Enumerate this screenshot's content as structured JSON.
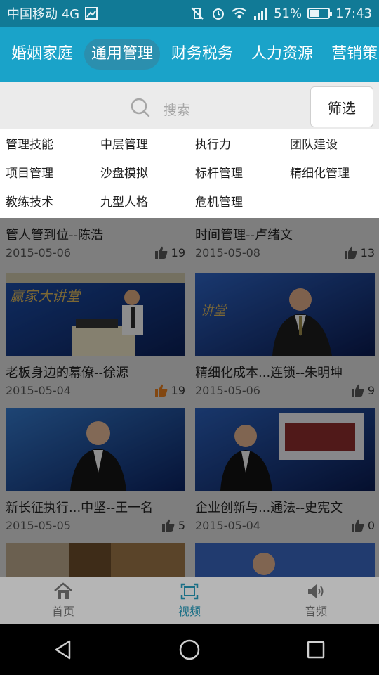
{
  "status": {
    "carrier": "中国移动 4G",
    "battery": "51%",
    "battery_level": 0.51,
    "time": "17:43"
  },
  "categories": [
    {
      "label": "婚姻家庭",
      "active": false
    },
    {
      "label": "通用管理",
      "active": true
    },
    {
      "label": "财务税务",
      "active": false
    },
    {
      "label": "人力资源",
      "active": false
    },
    {
      "label": "营销策",
      "active": false
    }
  ],
  "search": {
    "placeholder": "搜索",
    "filter_label": "筛选"
  },
  "filters": [
    "管理技能",
    "中层管理",
    "执行力",
    "团队建设",
    "项目管理",
    "沙盘模拟",
    "标杆管理",
    "精细化管理",
    "教练技术",
    "九型人格",
    "危机管理"
  ],
  "videos": [
    {
      "title": "管人管到位--陈浩",
      "date": "2015-05-06",
      "likes": "19",
      "liked": false
    },
    {
      "title": "时间管理--卢绪文",
      "date": "2015-05-08",
      "likes": "13",
      "liked": false
    },
    {
      "title": "老板身边的幕僚--徐源",
      "date": "2015-05-04",
      "likes": "19",
      "liked": true
    },
    {
      "title": "精细化成本...连锁--朱明坤",
      "date": "2015-05-06",
      "likes": "9",
      "liked": false
    },
    {
      "title": "新长征执行...中坚--王一名",
      "date": "2015-05-05",
      "likes": "5",
      "liked": false
    },
    {
      "title": "企业创新与...通法--史宪文",
      "date": "2015-05-04",
      "likes": "0",
      "liked": false
    }
  ],
  "nav": [
    {
      "label": "首页",
      "icon": "home-icon",
      "active": false
    },
    {
      "label": "视频",
      "icon": "video-icon",
      "active": true
    },
    {
      "label": "音频",
      "icon": "audio-icon",
      "active": false
    }
  ],
  "colors": {
    "accent": "#1aa3c9",
    "liked": "#e07a1e",
    "active_nav": "#1b6f86"
  }
}
